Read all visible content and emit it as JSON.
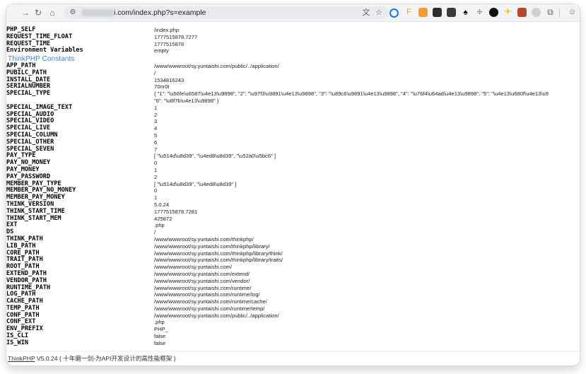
{
  "browser": {
    "url": "i.com/index.php?s=example",
    "back_icon": "arrow-left",
    "forward_icon": "arrow-right",
    "reload_icon": "reload",
    "home_icon": "home"
  },
  "rows_top": [
    {
      "key": "PHP_SELF",
      "value": "/index.php"
    },
    {
      "key": "REQUEST_TIME_FLOAT",
      "value": "1777515878.7277"
    },
    {
      "key": "REQUEST_TIME",
      "value": "1777515878"
    },
    {
      "key": "Environment Variables",
      "value": "empty"
    }
  ],
  "section_title": "ThinkPHP Constants",
  "rows": [
    {
      "key": "APP_PATH",
      "value": "/www/wwwroot/sy.yuntaishi.com/public/../application/"
    },
    {
      "key": "PUBILC_PATH",
      "value": "/"
    },
    {
      "key": "INSTALL_DATE",
      "value": "1534816243"
    },
    {
      "key": "SERIALNUMBER",
      "value": "70nr0t"
    },
    {
      "key": "SPECIAL_TYPE",
      "value": "{ \"1\": \"\\u56fe\\u6587\\u4e13\\u9898\", \"2\": \"\\u97f3\\u9891\\u4e13\\u9898\", \"3\": \"\\u89c6\\u9891\\u4e13\\u9898\", \"4\": \"\\u76f4\\u64ad\\u4e13\\u9898\", \"5\": \"\\u4e13\\u680f\\u4e13\\u9",
      "value2": "\"6\": \"\\u8f7b\\u4e13\\u9898\" }"
    },
    {
      "key": "SPECIAL_IMAGE_TEXT",
      "value": "1"
    },
    {
      "key": "SPECIAL_AUDIO",
      "value": "2"
    },
    {
      "key": "SPECIAL_VIDEO",
      "value": "3"
    },
    {
      "key": "SPECIAL_LIVE",
      "value": "4"
    },
    {
      "key": "SPECIAL_COLUMN",
      "value": "5"
    },
    {
      "key": "SPECIAL_OTHER",
      "value": "6"
    },
    {
      "key": "SPECIAL_SEVEN",
      "value": "7"
    },
    {
      "key": "PAY_TYPE",
      "value": "[ \"\\u514d\\u8d39\", \"\\u4ed8\\u8d39\", \"\\u52a0\\u5bc6\" ]"
    },
    {
      "key": "PAY_NO_MONEY",
      "value": "0"
    },
    {
      "key": "PAY_MONEY",
      "value": "1"
    },
    {
      "key": "PAY_PASSWORD",
      "value": "2"
    },
    {
      "key": "MEMBER_PAY_TYPE",
      "value": "[ \"\\u514d\\u8d39\", \"\\u4ed8\\u8d39\" ]"
    },
    {
      "key": "MEMBER_PAY_NO_MONEY",
      "value": "0"
    },
    {
      "key": "MEMBER_PAY_MONEY",
      "value": "1"
    },
    {
      "key": "THINK_VERSION",
      "value": "5.0.24"
    },
    {
      "key": "THINK_START_TIME",
      "value": "1777515878.7281"
    },
    {
      "key": "THINK_START_MEM",
      "value": "425872"
    },
    {
      "key": "EXT",
      "value": ".php"
    },
    {
      "key": "DS",
      "value": "/"
    },
    {
      "key": "THINK_PATH",
      "value": "/www/wwwroot/sy.yuntaishi.com/thinkphp/"
    },
    {
      "key": "LIB_PATH",
      "value": "/www/wwwroot/sy.yuntaishi.com/thinkphp/library/"
    },
    {
      "key": "CORE_PATH",
      "value": "/www/wwwroot/sy.yuntaishi.com/thinkphp/library/think/"
    },
    {
      "key": "TRAIT_PATH",
      "value": "/www/wwwroot/sy.yuntaishi.com/thinkphp/library/traits/"
    },
    {
      "key": "ROOT_PATH",
      "value": "/www/wwwroot/sy.yuntaishi.com/"
    },
    {
      "key": "EXTEND_PATH",
      "value": "/www/wwwroot/sy.yuntaishi.com/extend/"
    },
    {
      "key": "VENDOR_PATH",
      "value": "/www/wwwroot/sy.yuntaishi.com/vendor/"
    },
    {
      "key": "RUNTIME_PATH",
      "value": "/www/wwwroot/sy.yuntaishi.com/runtime/"
    },
    {
      "key": "LOG_PATH",
      "value": "/www/wwwroot/sy.yuntaishi.com/runtime/log/"
    },
    {
      "key": "CACHE_PATH",
      "value": "/www/wwwroot/sy.yuntaishi.com/runtime/cache/"
    },
    {
      "key": "TEMP_PATH",
      "value": "/www/wwwroot/sy.yuntaishi.com/runtime/temp/"
    },
    {
      "key": "CONF_PATH",
      "value": "/www/wwwroot/sy.yuntaishi.com/public/../application/"
    },
    {
      "key": "CONF_EXT",
      "value": ".php"
    },
    {
      "key": "ENV_PREFIX",
      "value": "PHP_"
    },
    {
      "key": "IS_CLI",
      "value": "false"
    },
    {
      "key": "IS_WIN",
      "value": "false"
    }
  ],
  "footer": {
    "link": "ThinkPHP",
    "text": " V5.0.24 { 十年磨一剑-为API开发设计的高性能框架 }"
  },
  "colors": {
    "section": "#4288ce",
    "toolbar": "#f1f3f4",
    "omnibox": "#e8eaed"
  }
}
